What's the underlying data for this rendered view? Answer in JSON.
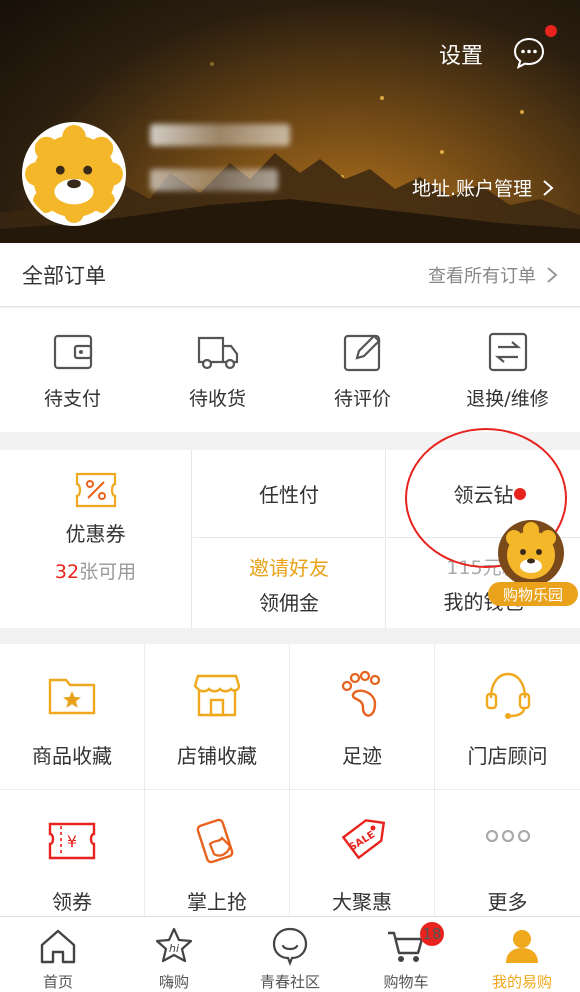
{
  "header": {
    "settings_label": "设置",
    "address_label": "地址.账户管理"
  },
  "orders": {
    "title": "全部订单",
    "view_all": "查看所有订单",
    "items": [
      {
        "label": "待支付",
        "icon": "wallet-icon"
      },
      {
        "label": "待收货",
        "icon": "truck-icon"
      },
      {
        "label": "待评价",
        "icon": "edit-icon"
      },
      {
        "label": "退换/维修",
        "icon": "exchange-icon"
      }
    ]
  },
  "wallet": {
    "coupon_label": "优惠券",
    "coupon_count": "32",
    "coupon_suffix": "张可用",
    "renxingfu": "任性付",
    "yunzuan": "领云钻",
    "invite_highlight": "邀请好友",
    "invite_label": "领佣金",
    "wallet_sub": "115元新",
    "wallet_label": "我的钱包"
  },
  "fun_park": "购物乐园",
  "tools": [
    {
      "label": "商品收藏",
      "icon": "folder-star-icon"
    },
    {
      "label": "店铺收藏",
      "icon": "store-icon"
    },
    {
      "label": "足迹",
      "icon": "footprint-icon"
    },
    {
      "label": "门店顾问",
      "icon": "headset-icon"
    },
    {
      "label": "领券",
      "icon": "ticket-icon"
    },
    {
      "label": "掌上抢",
      "icon": "phone-grab-icon"
    },
    {
      "label": "大聚惠",
      "icon": "sale-tag-icon"
    },
    {
      "label": "更多",
      "icon": "more-dots-icon"
    }
  ],
  "nav": {
    "cart_badge": "18",
    "items": [
      {
        "label": "首页",
        "icon": "home-icon"
      },
      {
        "label": "嗨购",
        "icon": "hi-star-icon"
      },
      {
        "label": "青春社区",
        "icon": "smile-chat-icon"
      },
      {
        "label": "购物车",
        "icon": "cart-icon"
      },
      {
        "label": "我的易购",
        "icon": "user-icon"
      }
    ]
  },
  "colors": {
    "accent": "#f0a81c",
    "red": "#e8231d",
    "header_dark": "#1d150b"
  }
}
